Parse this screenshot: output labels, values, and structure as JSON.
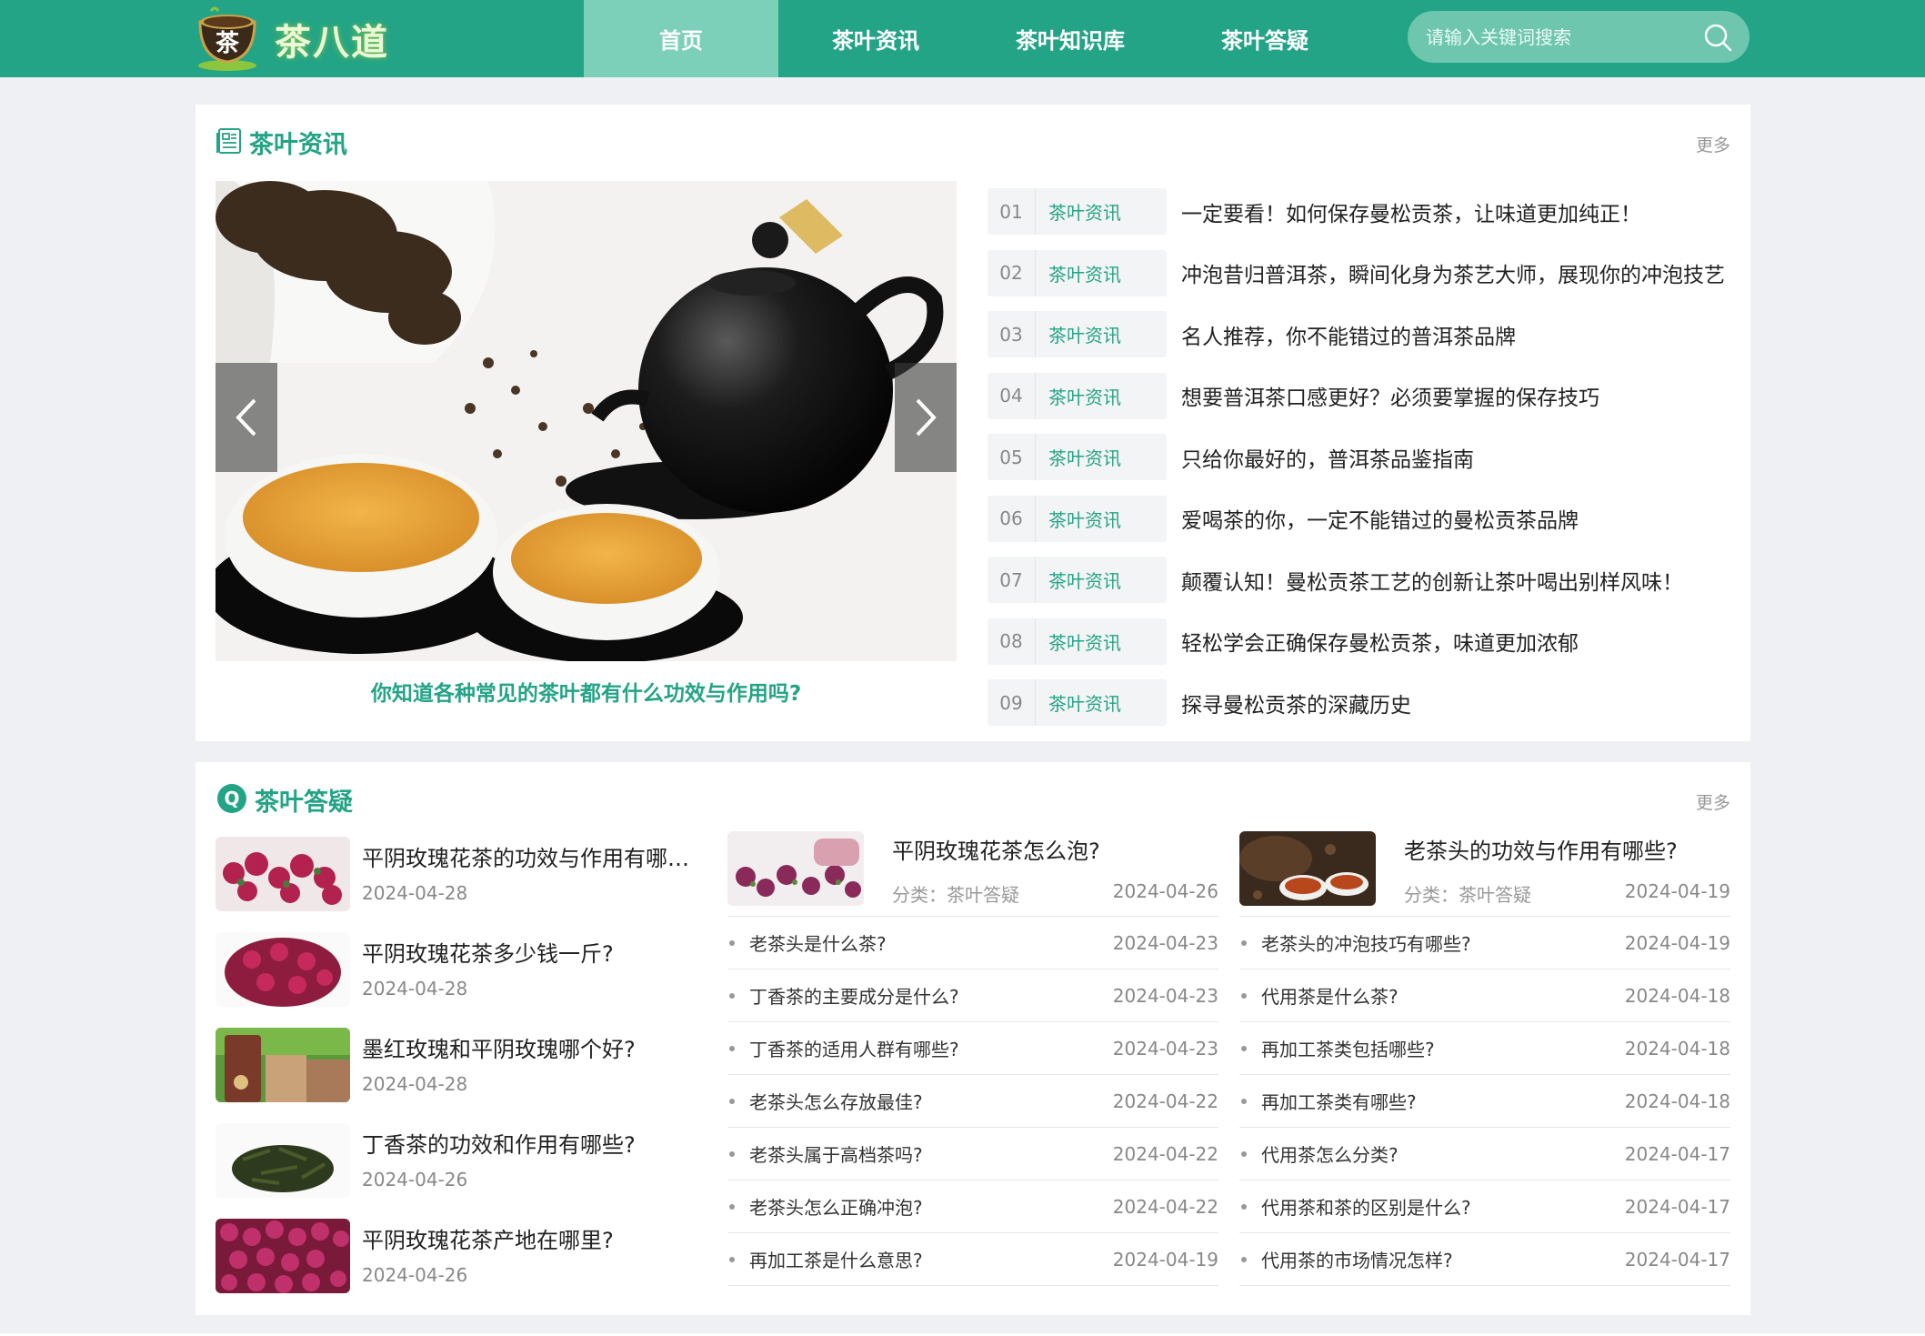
{
  "header": {
    "logo_text": "茶八道",
    "cup_char": "茶",
    "nav": [
      {
        "label": "首页",
        "active": true
      },
      {
        "label": "茶叶资讯",
        "active": false
      },
      {
        "label": "茶叶知识库",
        "active": false
      },
      {
        "label": "茶叶答疑",
        "active": false
      }
    ],
    "search_placeholder": "请输入关键词搜索"
  },
  "news": {
    "title": "茶叶资讯",
    "more": "更多",
    "slide_caption": "你知道各种常见的茶叶都有什么功效与作用吗?",
    "items": [
      {
        "num": "01",
        "cat": "茶叶资讯",
        "title": "一定要看！如何保存曼松贡茶，让味道更加纯正！"
      },
      {
        "num": "02",
        "cat": "茶叶资讯",
        "title": "冲泡昔归普洱茶，瞬间化身为茶艺大师，展现你的冲泡技艺"
      },
      {
        "num": "03",
        "cat": "茶叶资讯",
        "title": "名人推荐，你不能错过的普洱茶品牌"
      },
      {
        "num": "04",
        "cat": "茶叶资讯",
        "title": "想要普洱茶口感更好？必须要掌握的保存技巧"
      },
      {
        "num": "05",
        "cat": "茶叶资讯",
        "title": "只给你最好的，普洱茶品鉴指南"
      },
      {
        "num": "06",
        "cat": "茶叶资讯",
        "title": "爱喝茶的你，一定不能错过的曼松贡茶品牌"
      },
      {
        "num": "07",
        "cat": "茶叶资讯",
        "title": "颠覆认知！曼松贡茶工艺的创新让茶叶喝出别样风味！"
      },
      {
        "num": "08",
        "cat": "茶叶资讯",
        "title": "轻松学会正确保存曼松贡茶，味道更加浓郁"
      },
      {
        "num": "09",
        "cat": "茶叶资讯",
        "title": "探寻曼松贡茶的深藏历史"
      }
    ]
  },
  "qa": {
    "title": "茶叶答疑",
    "more": "更多",
    "col1": [
      {
        "title": "平阴玫瑰花茶的功效与作用有哪些？",
        "date": "2024-04-28",
        "thumb": "rose"
      },
      {
        "title": "平阴玫瑰花茶多少钱一斤?",
        "date": "2024-04-28",
        "thumb": "rose"
      },
      {
        "title": "墨红玫瑰和平阴玫瑰哪个好?",
        "date": "2024-04-28",
        "thumb": "box"
      },
      {
        "title": "丁香茶的功效和作用有哪些?",
        "date": "2024-04-26",
        "thumb": "leaf"
      },
      {
        "title": "平阴玫瑰花茶产地在哪里?",
        "date": "2024-04-26",
        "thumb": "rose"
      }
    ],
    "col2": {
      "featured": {
        "title": "平阴玫瑰花茶怎么泡?",
        "cat": "分类：茶叶答疑",
        "date": "2024-04-26"
      },
      "rows": [
        {
          "title": "老茶头是什么茶?",
          "date": "2024-04-23"
        },
        {
          "title": "丁香茶的主要成分是什么?",
          "date": "2024-04-23"
        },
        {
          "title": "丁香茶的适用人群有哪些?",
          "date": "2024-04-23"
        },
        {
          "title": "老茶头怎么存放最佳?",
          "date": "2024-04-22"
        },
        {
          "title": "老茶头属于高档茶吗?",
          "date": "2024-04-22"
        },
        {
          "title": "老茶头怎么正确冲泡?",
          "date": "2024-04-22"
        },
        {
          "title": "再加工茶是什么意思?",
          "date": "2024-04-19"
        }
      ]
    },
    "col3": {
      "featured": {
        "title": "老茶头的功效与作用有哪些?",
        "cat": "分类：茶叶答疑",
        "date": "2024-04-19"
      },
      "rows": [
        {
          "title": "老茶头的冲泡技巧有哪些?",
          "date": "2024-04-19"
        },
        {
          "title": "代用茶是什么茶?",
          "date": "2024-04-18"
        },
        {
          "title": "再加工茶类包括哪些?",
          "date": "2024-04-18"
        },
        {
          "title": "再加工茶类有哪些?",
          "date": "2024-04-18"
        },
        {
          "title": "代用茶怎么分类?",
          "date": "2024-04-17"
        },
        {
          "title": "代用茶和茶的区别是什么?",
          "date": "2024-04-17"
        },
        {
          "title": "代用茶的市场情况怎样?",
          "date": "2024-04-17"
        }
      ]
    }
  },
  "colors": {
    "brand": "#24a486",
    "nav_active": "#7ccfb9",
    "search_bg": "#6ec6ae"
  }
}
